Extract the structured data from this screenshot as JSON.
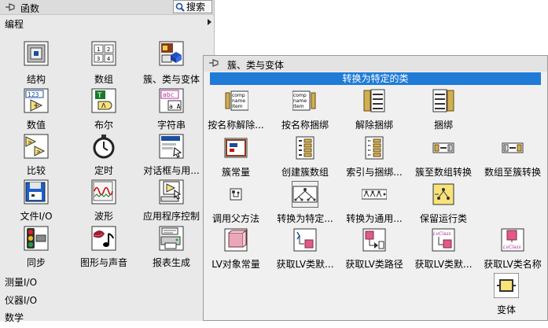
{
  "functions_palette": {
    "title": "函数",
    "search_label": "搜索",
    "category": "编程",
    "items": [
      {
        "label": "结构"
      },
      {
        "label": "数组"
      },
      {
        "label": "簇、类与变体"
      },
      {
        "label": "数值"
      },
      {
        "label": "布尔"
      },
      {
        "label": "字符串"
      },
      {
        "label": "比较"
      },
      {
        "label": "定时"
      },
      {
        "label": "对话框与用..."
      },
      {
        "label": "文件I/O"
      },
      {
        "label": "波形"
      },
      {
        "label": "应用程序控制"
      },
      {
        "label": "同步"
      },
      {
        "label": "图形与声音"
      },
      {
        "label": "报表生成"
      }
    ],
    "more_categories": [
      "测量I/O",
      "仪器I/O",
      "数学"
    ]
  },
  "subpalette": {
    "title": "簇、类与变体",
    "tooltip": "转换为特定的类",
    "items": [
      {
        "label": "按名称解除..."
      },
      {
        "label": "按名称捆绑"
      },
      {
        "label": "解除捆绑"
      },
      {
        "label": "捆绑"
      },
      {
        "label": "簇常量"
      },
      {
        "label": "创建簇数组"
      },
      {
        "label": "索引与捆绑..."
      },
      {
        "label": "簇至数组转换"
      },
      {
        "label": "数组至簇转换"
      },
      {
        "label": "调用父方法"
      },
      {
        "label": "转换为特定..."
      },
      {
        "label": "转换为通用..."
      },
      {
        "label": "保留运行类"
      },
      {
        "label": "LV对象常量"
      },
      {
        "label": "获取LV类默..."
      },
      {
        "label": "获取LV类路径"
      },
      {
        "label": "获取LV类默..."
      },
      {
        "label": "获取LV类名称"
      },
      {
        "label": "变体"
      }
    ],
    "icon_text": {
      "comp": "comp",
      "name": "name",
      "item": "item",
      "lvclass": "LvClass"
    }
  },
  "colors": {
    "selection": "#1f7bd6"
  }
}
